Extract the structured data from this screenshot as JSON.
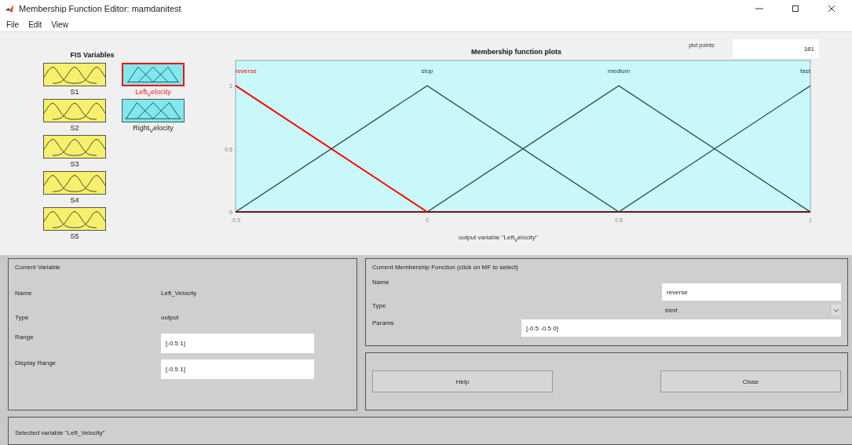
{
  "window": {
    "title": "Membership Function Editor: mamdanitest"
  },
  "menu": [
    "File",
    "Edit",
    "View"
  ],
  "fis_variables": {
    "title": "FIS Variables",
    "items": [
      {
        "label": "S1",
        "kind": "input",
        "selected": false
      },
      {
        "label": "S2",
        "kind": "input",
        "selected": false
      },
      {
        "label": "S3",
        "kind": "input",
        "selected": false
      },
      {
        "label": "S4",
        "kind": "input",
        "selected": false
      },
      {
        "label": "S5",
        "kind": "input",
        "selected": false
      },
      {
        "label": "Left$_{V}$elocity",
        "kind": "output",
        "selected": true
      },
      {
        "label": "Right$_{V}$elocity",
        "kind": "output",
        "selected": false
      }
    ]
  },
  "plot_points": {
    "label": "plot points:",
    "value": "181"
  },
  "plot": {
    "chart_data": {
      "type": "line",
      "title": "Membership function plots",
      "xlabel": "output variable \"Left$_{V}$elocity\"",
      "x": [
        -0.5,
        0,
        0.5,
        1
      ],
      "series": [
        {
          "name": "reverse",
          "color": "#ff0000",
          "values": [
            1,
            0,
            null,
            null
          ]
        },
        {
          "name": "stop",
          "color": "#1e3c3c",
          "values": [
            0,
            1,
            0,
            null
          ]
        },
        {
          "name": "medium",
          "color": "#1e3c3c",
          "values": [
            null,
            0,
            1,
            0
          ]
        },
        {
          "name": "fast",
          "color": "#1e3c3c",
          "values": [
            null,
            null,
            0,
            1
          ]
        }
      ],
      "xlim": [
        -0.5,
        1
      ],
      "ylim": [
        0,
        1.2
      ],
      "xticks": [
        {
          "value": -0.5,
          "label": "-0.5"
        },
        0,
        0.5,
        1
      ],
      "yticks": [
        0,
        0.5,
        1
      ]
    }
  },
  "current_variable": {
    "title": "Current Variable",
    "rows": [
      {
        "label": "Name",
        "value": "Left_Velocity",
        "kind": "text"
      },
      {
        "label": "Type",
        "value": "output",
        "kind": "text"
      },
      {
        "label": "Range",
        "value": "[-0.5 1]",
        "kind": "field"
      },
      {
        "label": "Display Range",
        "value": "[-0.5 1]",
        "kind": "field"
      }
    ]
  },
  "current_mf": {
    "title": "Current Membership Function (click on MF to select)",
    "rows": [
      {
        "label": "Name",
        "value": "reverse",
        "kind": "field"
      },
      {
        "label": "Type",
        "value": "trimf",
        "kind": "dropdown"
      },
      {
        "label": "Params",
        "value": "[-0.5 -0.5 0]",
        "kind": "wide_field"
      }
    ]
  },
  "buttons": [
    "Help",
    "Close"
  ],
  "status_bar": "Selected variable \"Left_Velocity\""
}
